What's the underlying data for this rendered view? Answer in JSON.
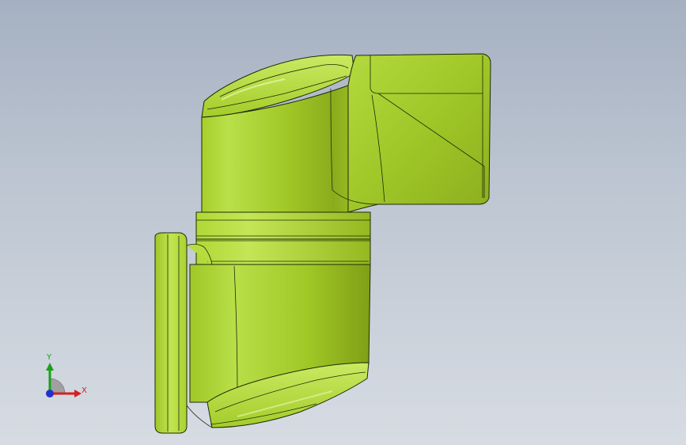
{
  "viewport": {
    "background_top": "#a5b0c1",
    "background_bottom": "#d7dce3"
  },
  "model": {
    "body_color": "#a8d22e",
    "body_light": "#c6e85c",
    "body_dark": "#7f9f18",
    "edge_color": "#1f2a08"
  },
  "triad": {
    "x_label": "X",
    "y_label": "Y",
    "x_color": "#d42020",
    "y_color": "#1aa01a",
    "origin_color": "#2233cc"
  }
}
